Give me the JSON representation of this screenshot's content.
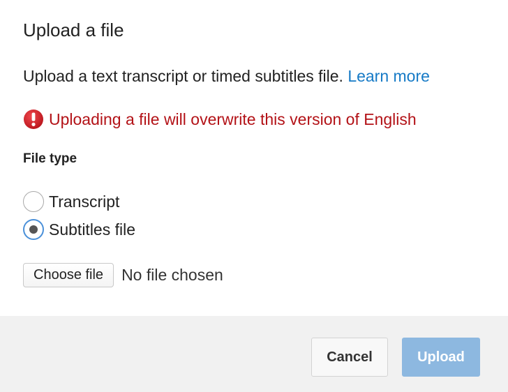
{
  "dialog": {
    "title": "Upload a file",
    "description": "Upload a text transcript or timed subtitles file.",
    "learn_more_link": "Learn more",
    "warning": {
      "icon": "error-exclamation-icon",
      "text": "Uploading a file will overwrite this version of English",
      "color": "#b31217"
    },
    "file_type": {
      "label": "File type",
      "options": [
        {
          "label": "Transcript",
          "selected": false
        },
        {
          "label": "Subtitles file",
          "selected": true
        }
      ]
    },
    "file_input": {
      "button_label": "Choose file",
      "status": "No file chosen"
    }
  },
  "footer": {
    "cancel_label": "Cancel",
    "upload_label": "Upload",
    "upload_color": "#8db8e0",
    "link_color": "#167ac6"
  }
}
